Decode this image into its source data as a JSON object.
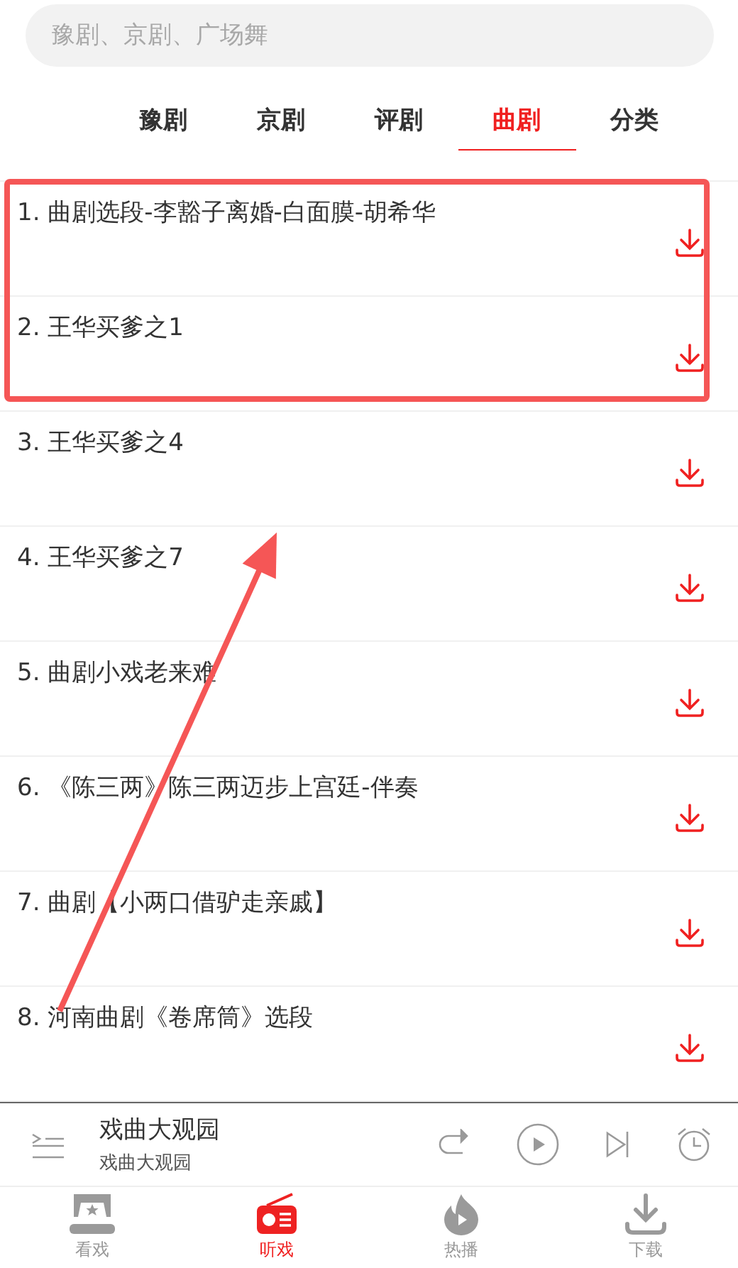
{
  "search": {
    "placeholder": "豫剧、京剧、广场舞"
  },
  "tabs": [
    {
      "label": "豫剧",
      "selected": false
    },
    {
      "label": "京剧",
      "selected": false
    },
    {
      "label": "评剧",
      "selected": false
    },
    {
      "label": "曲剧",
      "selected": true
    },
    {
      "label": "分类",
      "selected": false
    }
  ],
  "songs": [
    "1. 曲剧选段-李豁子离婚-白面膜-胡希华",
    "2. 王华买爹之1",
    "3. 王华买爹之4",
    "4. 王华买爹之7",
    "5. 曲剧小戏老来难",
    "6. 《陈三两》陈三两迈步上宫廷-伴奏",
    "7. 曲剧【小两口借驴走亲戚】",
    "8. 河南曲剧《卷席筒》选段"
  ],
  "player": {
    "title": "戏曲大观园",
    "subtitle": "戏曲大观园"
  },
  "nav": [
    {
      "label": "看戏",
      "selected": false
    },
    {
      "label": "听戏",
      "selected": true
    },
    {
      "label": "热播",
      "selected": false
    },
    {
      "label": "下载",
      "selected": false
    }
  ],
  "annotations": {
    "highlight_box": true,
    "arrow": true
  }
}
